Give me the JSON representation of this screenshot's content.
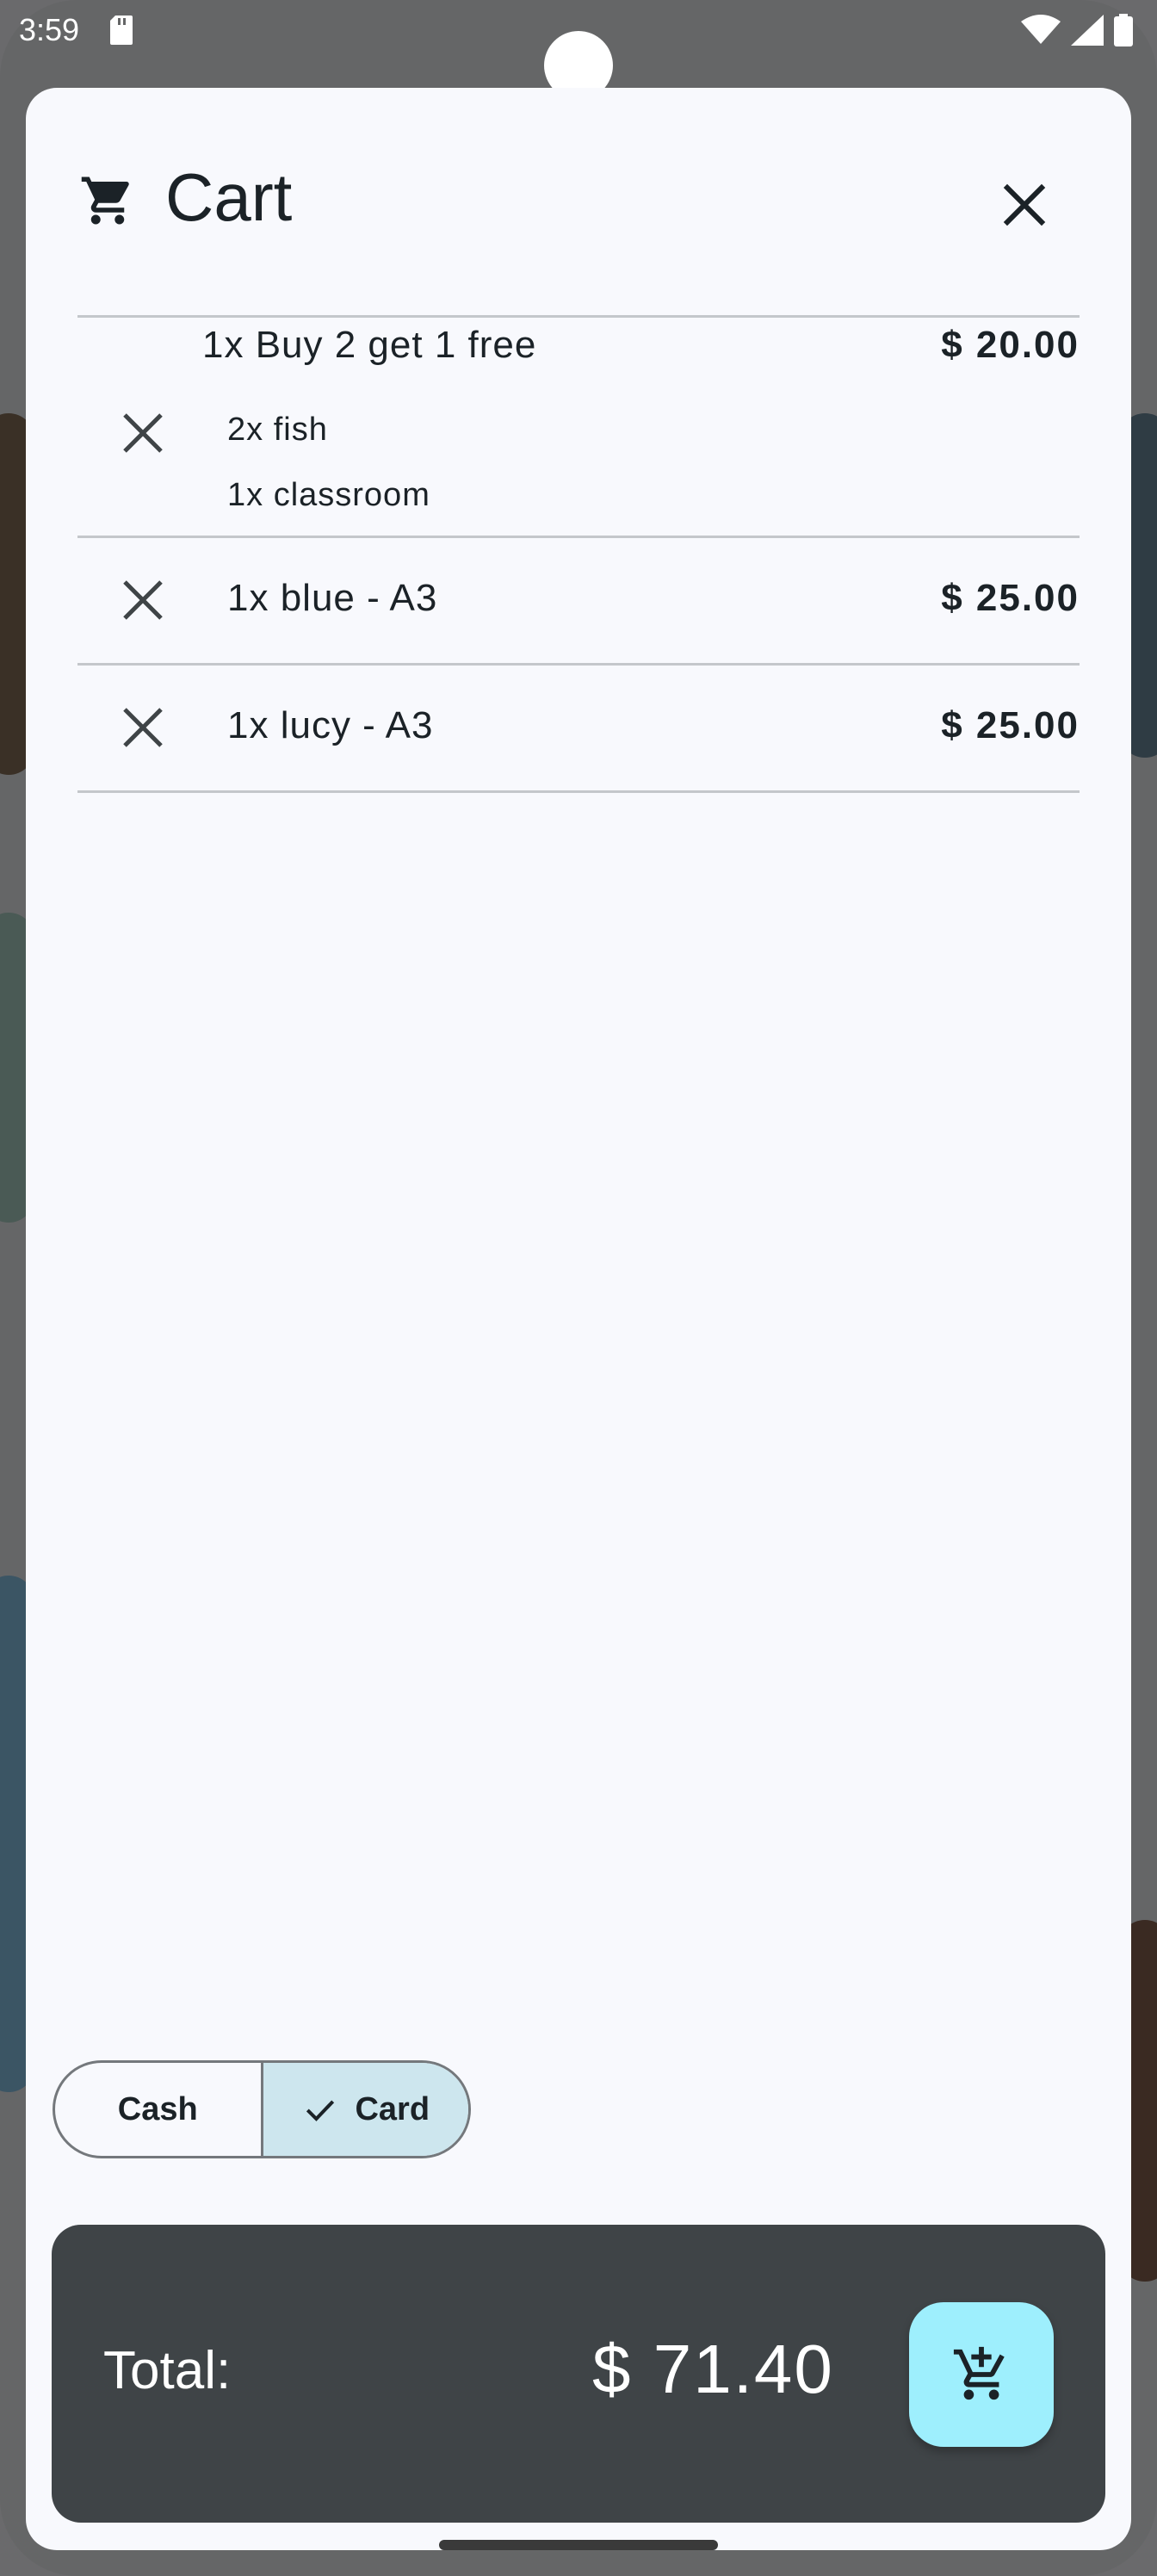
{
  "status_bar": {
    "time": "3:59",
    "icons": [
      "sd-card-icon",
      "wifi-icon",
      "signal-icon",
      "battery-icon"
    ]
  },
  "cart": {
    "title": "Cart",
    "title_icon": "cart-icon",
    "close_icon": "close-icon",
    "items": [
      {
        "label": "1x Buy 2 get 1 free",
        "price": "$ 20.00",
        "sub_items": [
          "2x fish",
          "1x classroom"
        ]
      },
      {
        "label": "1x blue - A3",
        "price": "$ 25.00"
      },
      {
        "label": "1x lucy - A3",
        "price": "$ 25.00"
      }
    ]
  },
  "payment": {
    "options": [
      {
        "label": "Cash",
        "selected": false
      },
      {
        "label": "Card",
        "selected": true
      }
    ]
  },
  "total": {
    "label": "Total:",
    "value": "$ 71.40",
    "checkout_icon": "add-shopping-cart-icon"
  },
  "colors": {
    "sheet_background": "#f8f9fd",
    "total_panel": "#3f4447",
    "checkout_button": "#9eeffd",
    "selected_segment": "#cde6ee"
  }
}
